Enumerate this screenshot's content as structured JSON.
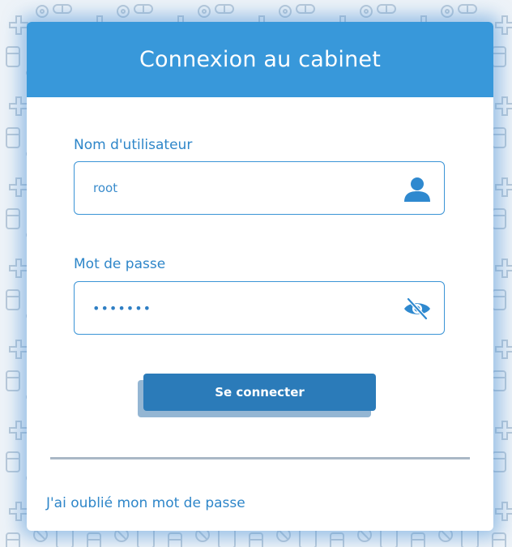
{
  "header": {
    "title": "Connexion au cabinet"
  },
  "username": {
    "label": "Nom d'utilisateur",
    "value": "root",
    "icon": "user-icon"
  },
  "password": {
    "label": "Mot de passe",
    "masked_value": "•••••••",
    "icon": "eye-slash-icon"
  },
  "submit": {
    "label": "Se connecter"
  },
  "forgot": {
    "label": "J'ai oublié mon mot de passe"
  },
  "colors": {
    "header": "#3898da",
    "accent": "#2e86c9",
    "button": "#2b7bb9",
    "pattern": "#b9c9d9"
  }
}
